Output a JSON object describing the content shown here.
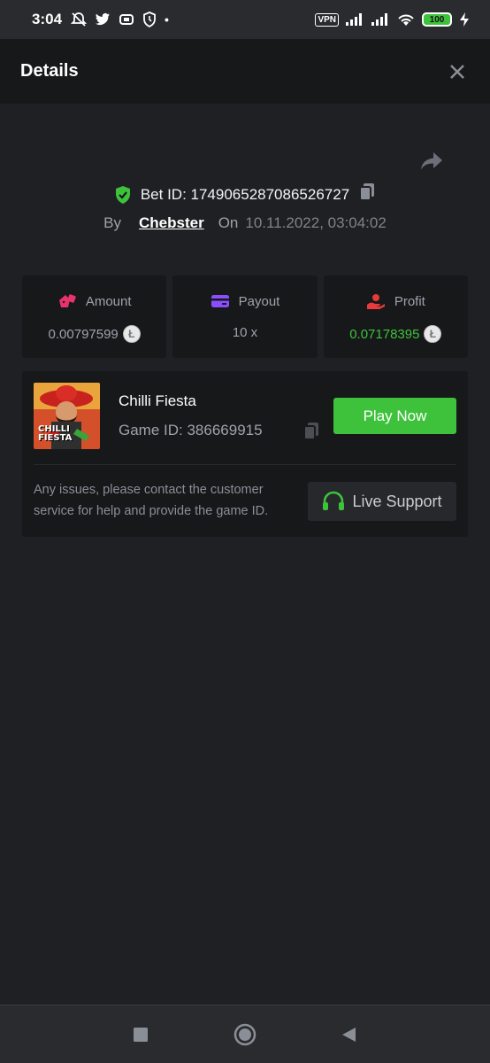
{
  "status_bar": {
    "time": "3:04",
    "vpn_label": "VPN",
    "battery": "100"
  },
  "header": {
    "title": "Details"
  },
  "bet": {
    "id_label": "Bet ID: 1749065287086526727",
    "by_label": "By",
    "username": "Chebster",
    "on_label": "On",
    "datetime": "10.11.2022, 03:04:02"
  },
  "stats": [
    {
      "label": "Amount",
      "value": "0.00797599",
      "icon": "dice-icon",
      "color": "#e6336b"
    },
    {
      "label": "Payout",
      "value": "10 x",
      "icon": "card-icon",
      "color": "#8a4dff"
    },
    {
      "label": "Profit",
      "value": "0.07178395",
      "icon": "profit-hand-icon",
      "color": "#e83a3a"
    }
  ],
  "game": {
    "name": "Chilli Fiesta",
    "id_label": "Game ID: 386669915",
    "play_label": "Play Now",
    "thumbnail_text_1": "CHILLI",
    "thumbnail_text_2": "FIESTA",
    "issues_text": "Any issues, please contact the customer service for help and provide the game ID.",
    "support_label": "Live Support"
  },
  "colors": {
    "accent_green": "#3ec23c",
    "background": "#1f2023",
    "card": "#17181a"
  }
}
